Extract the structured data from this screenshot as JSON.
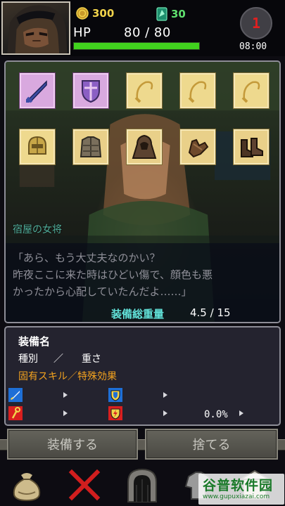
{
  "header": {
    "portrait_icon": "hooded-hero-portrait",
    "coins": "300",
    "gems": "30",
    "hp_label": "HP",
    "hp_value": "80 / 80",
    "hp_ratio": 1.0,
    "day": "1",
    "time": "08:00"
  },
  "equipment_grid": {
    "slots": [
      {
        "icon": "sword-icon",
        "state": "selected"
      },
      {
        "icon": "shield-icon",
        "state": "selected"
      },
      {
        "icon": "whip-icon",
        "state": "empty"
      },
      {
        "icon": "whip-icon",
        "state": "empty"
      },
      {
        "icon": "whip-icon",
        "state": "empty"
      },
      {
        "icon": "helmet-icon",
        "state": "empty"
      },
      {
        "icon": "leather-vest-icon",
        "state": "item"
      },
      {
        "icon": "hooded-cloak-icon",
        "state": "item"
      },
      {
        "icon": "leather-gloves-icon",
        "state": "item"
      },
      {
        "icon": "leather-boots-icon",
        "state": "item"
      }
    ]
  },
  "scene": {
    "speaker": "宿屋の女将",
    "dialog_lines": [
      "「あら、もう大丈夫なのかい？",
      "昨夜ここに来た時はひどい傷で、顔色も悪",
      "かったから心配していたんだよ……」"
    ]
  },
  "weight": {
    "label": "装備総重量",
    "value": "4.5 / 15"
  },
  "info": {
    "name": "装備名",
    "type": "種別",
    "separator": "／",
    "weight": "重さ",
    "skill": "固有スキル／特殊効果",
    "percent": "0.0%"
  },
  "actions": {
    "equip": "装備する",
    "discard": "捨てる"
  },
  "nav": {
    "items": [
      "bag-icon",
      "close-icon",
      "dungeon-door-icon",
      "armor-icon",
      "shop-icon"
    ]
  },
  "watermark": {
    "brand": "谷普软件园",
    "url": "www.gupuxiazai.com"
  },
  "colors": {
    "coin": "#f1d34b",
    "gem": "#5fe06e",
    "hp_bar": "#41d31e",
    "day": "#e21f1f",
    "slot_selected": "#d9a9df",
    "slot_empty": "#eed98e",
    "weight_label": "#62e3da",
    "skill_text": "#f2a21f"
  }
}
